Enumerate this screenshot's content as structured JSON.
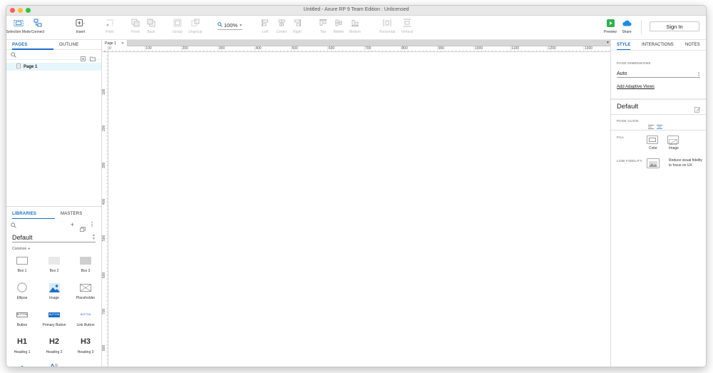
{
  "window": {
    "title": "Untitled - Axure RP 9 Team Edition : Unlicensed"
  },
  "toolbar": {
    "items": [
      {
        "label": "Selection Mode",
        "icon": "selection-mode-icon",
        "enabled": true
      },
      {
        "label": "Connect",
        "icon": "connect-icon",
        "enabled": true
      },
      {
        "label": "Insert",
        "icon": "insert-icon",
        "enabled": true
      },
      {
        "label": "Point",
        "icon": "point-icon",
        "enabled": false
      },
      {
        "label": "Front",
        "icon": "front-icon",
        "enabled": false
      },
      {
        "label": "Back",
        "icon": "back-icon",
        "enabled": false
      },
      {
        "label": "Group",
        "icon": "group-icon",
        "enabled": false
      },
      {
        "label": "Ungroup",
        "icon": "ungroup-icon",
        "enabled": false
      },
      {
        "label": "Left",
        "icon": "align-left-icon",
        "enabled": false
      },
      {
        "label": "Center",
        "icon": "align-center-icon",
        "enabled": false
      },
      {
        "label": "Right",
        "icon": "align-right-icon",
        "enabled": false
      },
      {
        "label": "Top",
        "icon": "align-top-icon",
        "enabled": false
      },
      {
        "label": "Middle",
        "icon": "align-middle-icon",
        "enabled": false
      },
      {
        "label": "Bottom",
        "icon": "align-bottom-icon",
        "enabled": false
      },
      {
        "label": "Horizontal",
        "icon": "distribute-horizontal-icon",
        "enabled": false
      },
      {
        "label": "Vertical",
        "icon": "distribute-vertical-icon",
        "enabled": false
      }
    ],
    "zoom": "100%",
    "preview_label": "Preview",
    "share_label": "Share",
    "signin_label": "Sign In"
  },
  "pages_panel": {
    "tabs": [
      "PAGES",
      "OUTLINE"
    ],
    "active_tab": "PAGES",
    "pages": [
      {
        "name": "Page 1"
      }
    ]
  },
  "libraries_panel": {
    "tabs": [
      "LIBRARIES",
      "MASTERS"
    ],
    "active_tab": "LIBRARIES",
    "library": "Default",
    "category": "Common",
    "widgets": [
      {
        "label": "Box 1"
      },
      {
        "label": "Box 2"
      },
      {
        "label": "Box 3"
      },
      {
        "label": "Ellipse"
      },
      {
        "label": "Image"
      },
      {
        "label": "Placeholder"
      },
      {
        "label": "Button",
        "text": "BUTTON"
      },
      {
        "label": "Primary Button",
        "text": "BUTTON"
      },
      {
        "label": "Link Button",
        "text": "BUTTON"
      },
      {
        "label": "Heading 1",
        "text": "H1"
      },
      {
        "label": "Heading 2",
        "text": "H2"
      },
      {
        "label": "Heading 3",
        "text": "H3"
      }
    ]
  },
  "canvas": {
    "tab_label": "Page 1",
    "ruler_h": [
      "0",
      "100",
      "200",
      "300",
      "400",
      "500",
      "600",
      "700",
      "800",
      "900",
      "1000",
      "1100",
      "1200",
      "1300"
    ],
    "ruler_v": [
      "100",
      "200",
      "300",
      "400",
      "500",
      "600",
      "700",
      "800"
    ]
  },
  "right_panel": {
    "tabs": [
      "STYLE",
      "INTERACTIONS",
      "NOTES"
    ],
    "active_tab": "STYLE",
    "page_dimensions_label": "PAGE DIMENSIONS",
    "page_dimensions_value": "Auto",
    "adaptive_link": "Add Adaptive Views",
    "style_name": "Default",
    "page_align_label": "PAGE ALIGN",
    "fill_label": "FILL",
    "fill_color_label": "Color",
    "fill_image_label": "Image",
    "low_fidelity_label": "LOW FIDELITY",
    "low_fidelity_text": "Reduce visual fidelity to focus on UX"
  },
  "colors": {
    "accent": "#1a6ec8",
    "selected_page_bg": "#e6f6fb",
    "preview_green": "#2bb24c",
    "share_blue": "#1b8ce3"
  }
}
